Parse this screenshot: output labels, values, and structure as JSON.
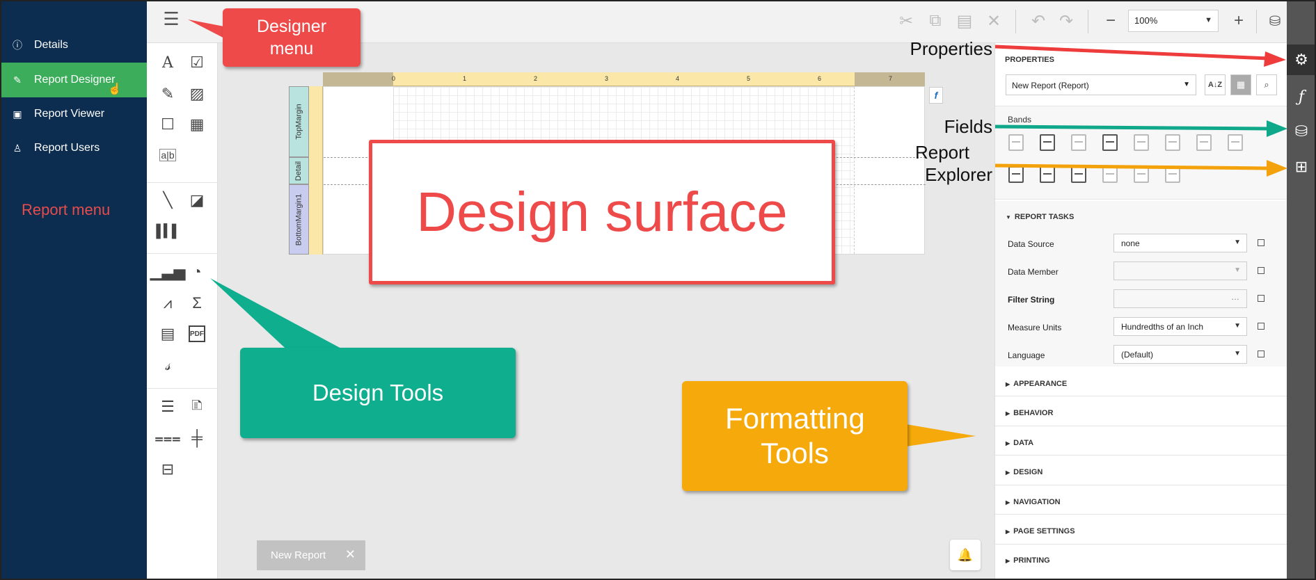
{
  "nav": {
    "items": [
      {
        "label": "Details",
        "icon": "info-icon",
        "glyph": "ⓘ"
      },
      {
        "label": "Report Designer",
        "icon": "edit-icon",
        "glyph": "✎"
      },
      {
        "label": "Report Viewer",
        "icon": "report-viewer-icon",
        "glyph": "▣"
      },
      {
        "label": "Report Users",
        "icon": "users-icon",
        "glyph": "♙"
      }
    ],
    "active_index": 1,
    "section_label": "Report menu"
  },
  "toolbar": {
    "zoom_value": "100%"
  },
  "ruler": {
    "numbers": [
      "0",
      "1",
      "2",
      "3",
      "4",
      "5",
      "6",
      "7"
    ]
  },
  "bands": {
    "top_margin": "TopMargin",
    "detail": "Detail",
    "bottom_margin": "BottomMargin1"
  },
  "document_tab": {
    "label": "New Report",
    "close": "✕"
  },
  "properties": {
    "title": "PROPERTIES",
    "selected_object": "New Report (Report)",
    "bands_label": "Bands",
    "report_tasks_header": "REPORT TASKS",
    "rows": [
      {
        "label": "Data Source",
        "value": "none",
        "bold": false,
        "disabled": false
      },
      {
        "label": "Data Member",
        "value": "",
        "bold": false,
        "disabled": true
      },
      {
        "label": "Filter String",
        "value": "",
        "bold": true,
        "disabled": true
      },
      {
        "label": "Measure Units",
        "value": "Hundredths of an Inch",
        "bold": false,
        "disabled": false
      },
      {
        "label": "Language",
        "value": "(Default)",
        "bold": false,
        "disabled": false
      }
    ],
    "sections": [
      "APPEARANCE",
      "BEHAVIOR",
      "DATA",
      "DESIGN",
      "NAVIGATION",
      "PAGE SETTINGS",
      "PRINTING"
    ]
  },
  "annotations": {
    "designer_menu": "Designer menu",
    "design_surface": "Design surface",
    "design_tools": "Design Tools",
    "formatting_tools": "Formatting Tools",
    "properties": "Properties",
    "fields": "Fields",
    "report_explorer_line1": "Report",
    "report_explorer_line2": "Explorer"
  },
  "colors": {
    "nav_bg": "#0d2d50",
    "nav_active": "#3cae5b",
    "callout_red": "#ef4a4a",
    "callout_green": "#0fae8f",
    "callout_orange": "#f5a90a",
    "arrow_red": "#ee3b3b",
    "arrow_green": "#10a88a",
    "arrow_orange": "#f4a20c"
  }
}
